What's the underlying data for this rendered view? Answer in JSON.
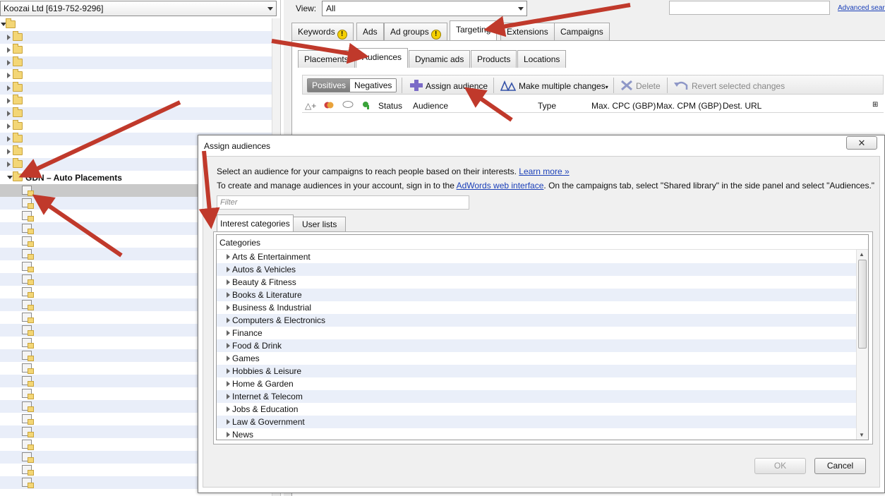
{
  "left_panel": {
    "account": "Koozai Ltd [619-752-9296]",
    "gdn_campaign": "GDN – Auto Placements"
  },
  "header": {
    "view_label": "View:",
    "view_value": "All",
    "advanced_search": "Advanced search"
  },
  "top_tabs": [
    "Keywords",
    "Ads",
    "Ad groups",
    "Targeting",
    "Extensions",
    "Campaigns"
  ],
  "sub_tabs": [
    "Placements",
    "Audiences",
    "Dynamic ads",
    "Products",
    "Locations"
  ],
  "toolbar": {
    "positives": "Positives",
    "negatives": "Negatives",
    "assign_audience": "Assign audience",
    "make_multiple_changes": "Make multiple changes",
    "delete": "Delete",
    "revert": "Revert selected changes"
  },
  "columns": [
    "Status",
    "Audience",
    "Type",
    "Max. CPC (GBP)",
    "Max. CPM (GBP)",
    "Dest. URL"
  ],
  "dialog": {
    "title": "Assign audiences",
    "close": "✕",
    "line1": "Select an audience for your campaigns to reach people based on their interests.",
    "learn_more": "Learn more »",
    "line2_a": "To create and manage audiences in your account, sign in to the",
    "adwords_link": "AdWords web interface",
    "line2_b": ". On the campaigns tab, select \"Shared library\" in the side panel and select \"Audiences.\"",
    "filter_placeholder": "Filter",
    "tab_interest": "Interest categories",
    "tab_user_lists": "User lists",
    "categories_header": "Categories",
    "categories": [
      "Arts & Entertainment",
      "Autos & Vehicles",
      "Beauty & Fitness",
      "Books & Literature",
      "Business & Industrial",
      "Computers & Electronics",
      "Finance",
      "Food & Drink",
      "Games",
      "Hobbies & Leisure",
      "Home & Garden",
      "Internet & Telecom",
      "Jobs & Education",
      "Law & Government",
      "News"
    ],
    "ok": "OK",
    "cancel": "Cancel"
  },
  "colors": {
    "arrow": "#c0392b",
    "link": "#1a3fb8",
    "row_alt": "#e9eef9"
  }
}
